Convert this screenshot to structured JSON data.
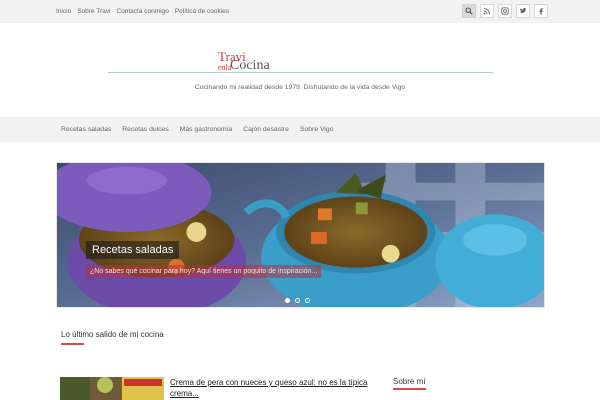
{
  "top_nav": {
    "items": [
      "Inicio",
      "Sobre Travi",
      "Contacta conmigo",
      "Política de cookies"
    ]
  },
  "social": {
    "icons": [
      "search-icon",
      "rss-icon",
      "instagram-icon",
      "twitter-icon",
      "facebook-icon"
    ]
  },
  "header": {
    "logo_travi": "Travi",
    "logo_enla": "enla",
    "logo_cocina": "Cocina",
    "tagline": "Cocinando mi realidad desde 1979. Disfrutando de la vida desde Vigo"
  },
  "main_nav": {
    "items": [
      "Recetas saladas",
      "Recetas dulces",
      "Más gastronomía",
      "Cajón desastre",
      "Sobre Vigo"
    ]
  },
  "slider": {
    "title": "Recetas saladas",
    "subtitle": "¿No sabes qué cocinar para hoy? Aquí tienes un poquito de inspiración...",
    "slide_count": 3,
    "active_slide": 1
  },
  "latest": {
    "heading": "Lo último salido de mi cocina",
    "post_title": "Crema de pera con nueces y queso azul: no es la típica crema..."
  },
  "sidebar": {
    "heading": "Sobre mí"
  },
  "colors": {
    "accent": "#d84a4a",
    "logo_red": "#c23a3a",
    "bar_bg": "#f2f2f2"
  }
}
